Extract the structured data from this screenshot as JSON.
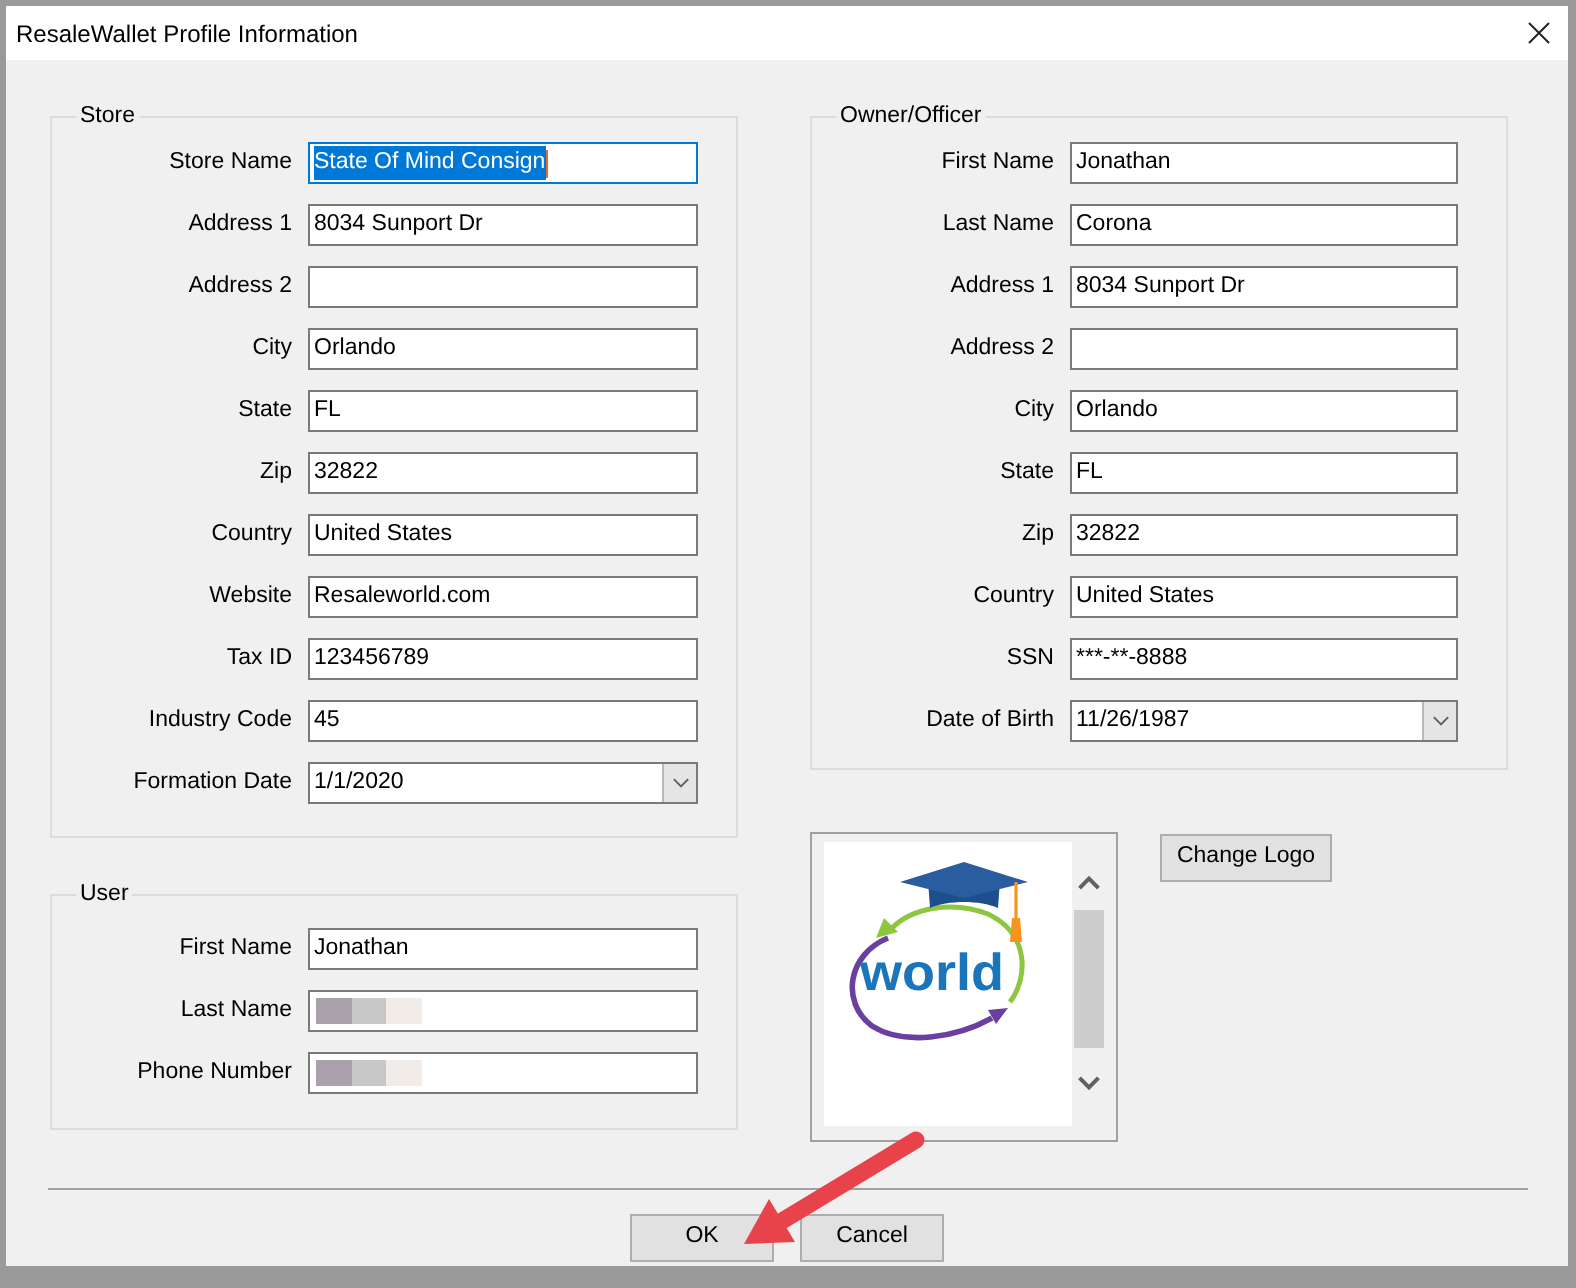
{
  "window": {
    "title": "ResaleWallet Profile Information"
  },
  "store": {
    "title": "Store",
    "fields": [
      {
        "label": "Store Name",
        "value": "State Of Mind Consign",
        "kind": "text",
        "text_selected": true
      },
      {
        "label": "Address 1",
        "value": "8034 Sunport Dr",
        "kind": "text",
        "text_selected": false
      },
      {
        "label": "Address 2",
        "kind": "text",
        "text_selected": false
      },
      {
        "label": "City",
        "value": "Orlando",
        "kind": "text",
        "text_selected": false
      },
      {
        "label": "State",
        "value": "FL",
        "kind": "text",
        "text_selected": false
      },
      {
        "label": "Zip",
        "value": "32822",
        "kind": "text",
        "text_selected": false
      },
      {
        "label": "Country",
        "value": "United States",
        "kind": "text",
        "text_selected": false
      },
      {
        "label": "Website",
        "value": "Resaleworld.com",
        "kind": "text",
        "text_selected": false
      },
      {
        "label": "Tax ID",
        "value": "123456789",
        "kind": "text",
        "text_selected": false
      },
      {
        "label": "Industry Code",
        "value": "45",
        "kind": "text",
        "text_selected": false
      },
      {
        "label": "Formation Date",
        "value": "1/1/2020",
        "kind": "date",
        "text_selected": false
      }
    ]
  },
  "user": {
    "title": "User",
    "fields": [
      {
        "label": "First Name",
        "value": "Jonathan",
        "kind": "text",
        "redacted": false
      },
      {
        "label": "Last Name",
        "kind": "text",
        "redacted": true
      },
      {
        "label": "Phone Number",
        "kind": "text",
        "redacted": true
      }
    ]
  },
  "owner": {
    "title": "Owner/Officer",
    "fields": [
      {
        "label": "First Name",
        "value": "Jonathan",
        "kind": "text"
      },
      {
        "label": "Last Name",
        "value": "Corona",
        "kind": "text"
      },
      {
        "label": "Address 1",
        "value": "8034 Sunport Dr",
        "kind": "text"
      },
      {
        "label": "Address 2",
        "kind": "text"
      },
      {
        "label": "City",
        "value": "Orlando",
        "kind": "text"
      },
      {
        "label": "State",
        "value": "FL",
        "kind": "text"
      },
      {
        "label": "Zip",
        "value": "32822",
        "kind": "text"
      },
      {
        "label": "Country",
        "value": "United States",
        "kind": "text"
      },
      {
        "label": "SSN",
        "value": "***-**-8888",
        "kind": "text"
      },
      {
        "label": "Date of Birth",
        "value": "11/26/1987",
        "kind": "date"
      }
    ]
  },
  "logo": {
    "wordmark": "world",
    "change_button": "Change Logo"
  },
  "buttons": [
    "OK",
    "Cancel"
  ]
}
